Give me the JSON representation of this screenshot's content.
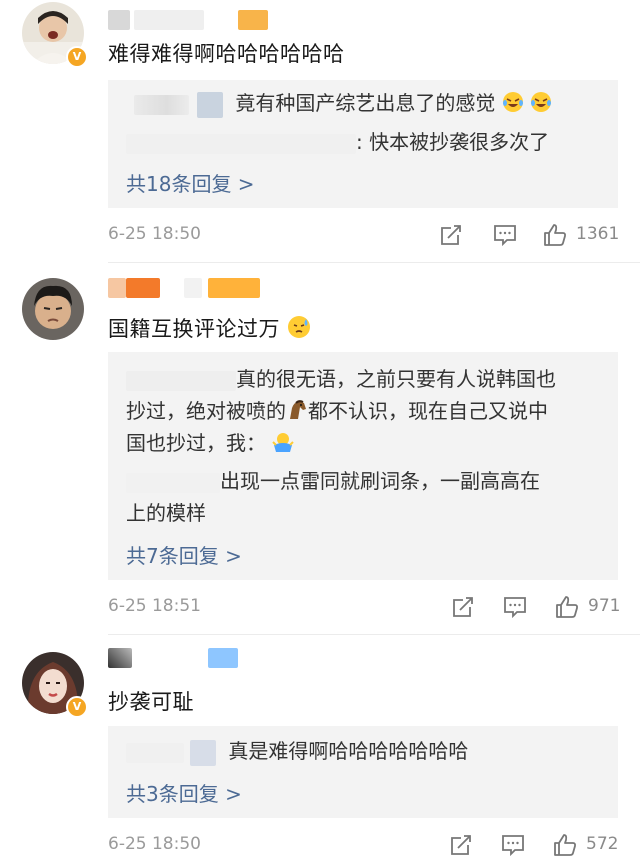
{
  "comments": [
    {
      "text": "难得难得啊哈哈哈哈哈哈",
      "replies": [
        {
          "text": "竟有种国产综艺出息了的感觉"
        },
        {
          "text": ": 快本被抄袭很多次了"
        }
      ],
      "more": "共18条回复 >",
      "time": "6-25 18:50",
      "likes": "1361"
    },
    {
      "text": "国籍互换评论过万",
      "replies": [
        {
          "line1": "真的很无语，之前只要有人说韩国也",
          "line2a": "抄过，绝对被喷的",
          "line2b": "都不认识，现在自己又说中",
          "line3": "国也抄过，我："
        },
        {
          "line1": "出现一点雷同就刷词条，一副高高在",
          "line2": "上的模样"
        }
      ],
      "more": "共7条回复 >",
      "time": "6-25 18:51",
      "likes": "971"
    },
    {
      "text": "抄袭可耻",
      "replies": [
        {
          "text": "真是难得啊哈哈哈哈哈哈哈"
        }
      ],
      "more": "共3条回复 >",
      "time": "6-25 18:50",
      "likes": "572"
    }
  ],
  "badge_label": "V",
  "colors": {
    "link": "#4c6a94",
    "badge": "#f5a623",
    "meta": "#9a9a9a"
  }
}
